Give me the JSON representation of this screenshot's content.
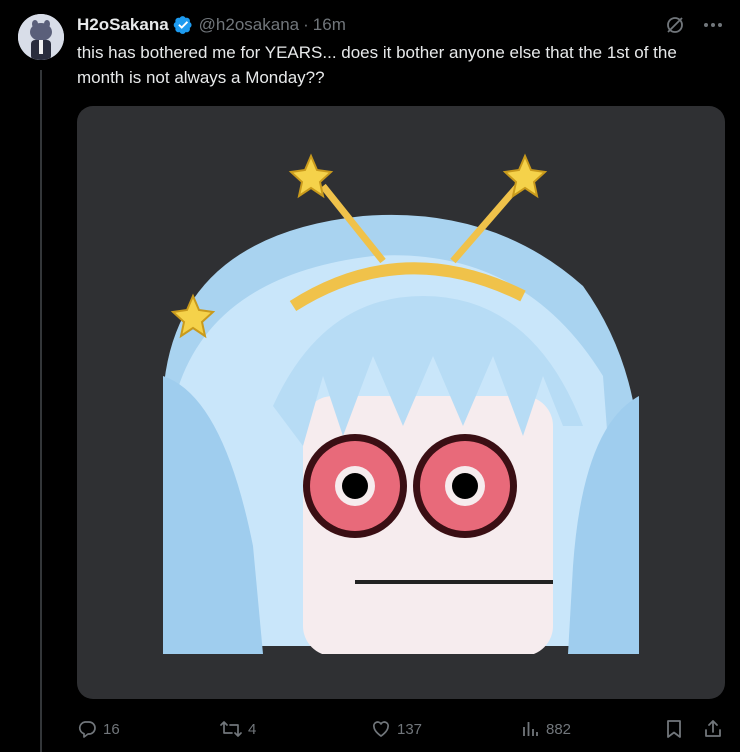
{
  "tweet": {
    "author_name": "H2oSakana",
    "handle": "@h2osakana",
    "separator": "·",
    "time": "16m",
    "text": "this has bothered me for YEARS... does it bother anyone else that the 1st of the month is not always a Monday??",
    "verified": true
  },
  "icons": {
    "grok": "grok-icon",
    "more": "more-icon",
    "reply": "reply-icon",
    "retweet": "retweet-icon",
    "like": "heart-icon",
    "views": "views-icon",
    "bookmark": "bookmark-icon",
    "share": "share-icon"
  },
  "actions": {
    "replies": "16",
    "retweets": "4",
    "likes": "137",
    "views": "882"
  },
  "colors": {
    "background": "#000000",
    "text": "#e7e9ea",
    "muted": "#71767b",
    "verified": "#1d9bf0",
    "media_bg": "#2f3033"
  }
}
